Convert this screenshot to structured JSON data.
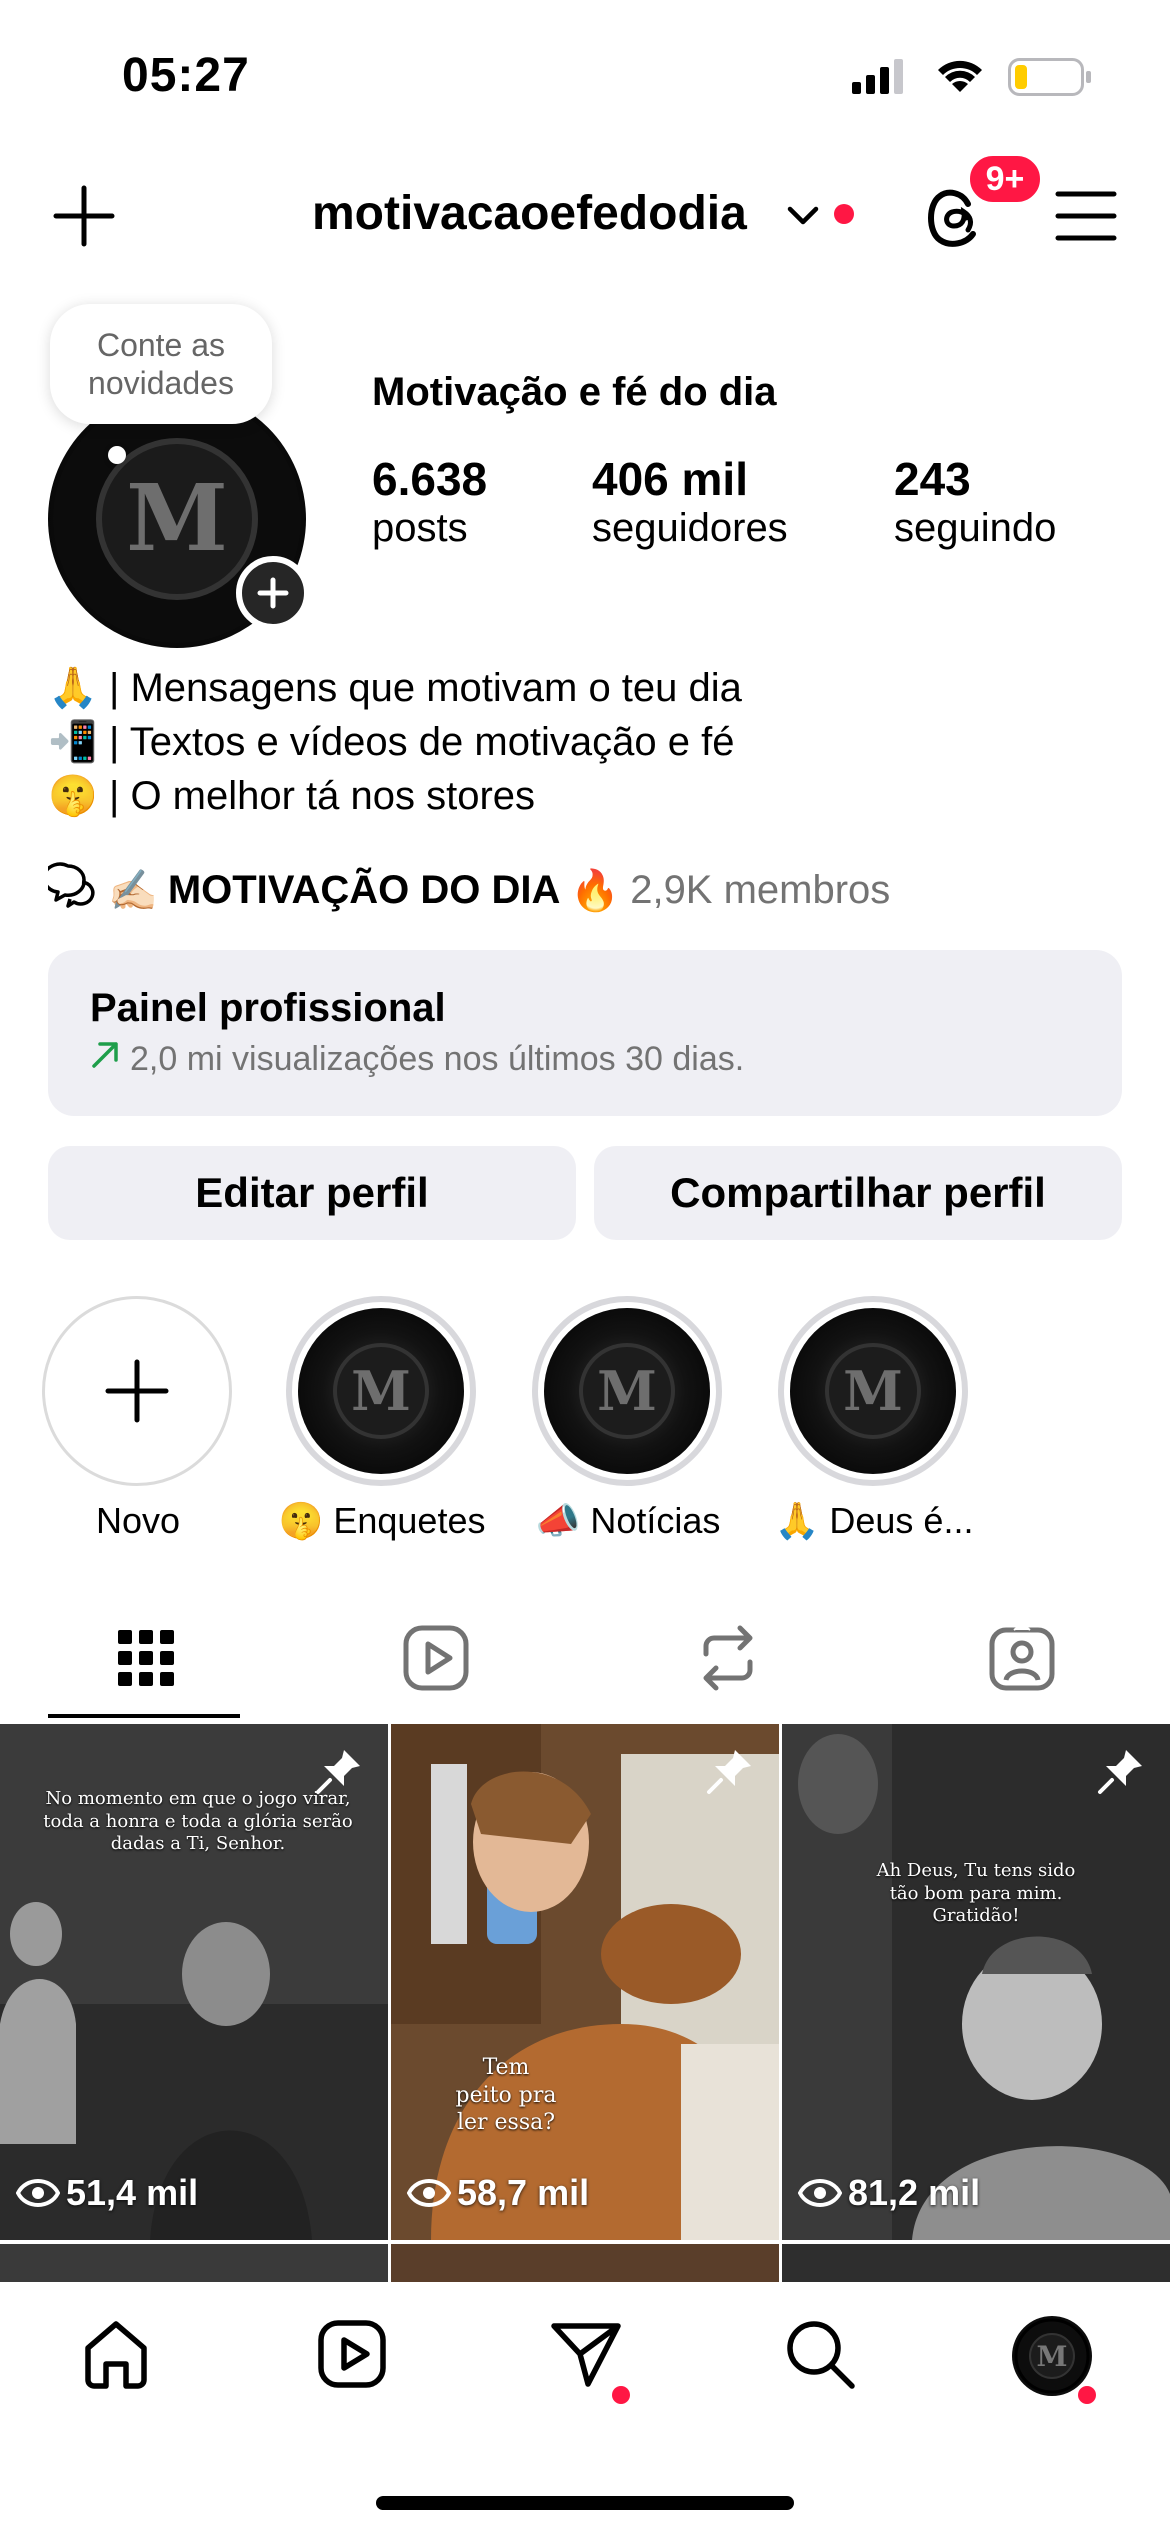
{
  "status_bar": {
    "time": "05:27"
  },
  "header": {
    "username": "motivacaoefedodia",
    "notif_count": "9+"
  },
  "profile": {
    "note": "Conte as novidades",
    "display_name": "Motivação e fé do dia",
    "stats": [
      {
        "value": "6.638",
        "label": "posts"
      },
      {
        "value": "406 mil",
        "label": "seguidores"
      },
      {
        "value": "243",
        "label": "seguindo"
      }
    ],
    "bio": [
      {
        "emoji": "🙏",
        "text": "| Mensagens que motivam o teu dia"
      },
      {
        "emoji": "📲",
        "text": "| Textos e vídeos de motivação e fé"
      },
      {
        "emoji": "🤫",
        "text": "| O melhor tá nos stores"
      }
    ],
    "channel": {
      "prefix": "✍🏻",
      "name": "MOTIVAÇÃO DO DIA",
      "suffix": "🔥",
      "members": "2,9K membros"
    }
  },
  "dashboard": {
    "title": "Painel profissional",
    "subtitle": "2,0 mi visualizações nos últimos 30 dias."
  },
  "buttons": {
    "edit": "Editar perfil",
    "share": "Compartilhar perfil"
  },
  "highlights": [
    {
      "label": "Novo"
    },
    {
      "label": "🤫 Enquetes"
    },
    {
      "label": "📣 Notícias"
    },
    {
      "label": "🙏 Deus é..."
    }
  ],
  "tabs": [
    "grid-icon",
    "reels-icon",
    "reposts-icon",
    "tagged-icon"
  ],
  "posts": [
    {
      "caption": "No momento em que o jogo virar, toda a honra e toda a glória serão dadas a Ti, Senhor.",
      "views": "51,4 mil"
    },
    {
      "caption": "Tem peito pra ler essa?",
      "views": "58,7 mil"
    },
    {
      "caption": "Ah Deus, Tu tens sido tão bom para mim. Gratidão!",
      "views": "81,2 mil"
    }
  ],
  "colors": {
    "accent_red": "#ff1744",
    "panel_bg": "#efeff4",
    "trend_green": "#1e9e4a"
  }
}
